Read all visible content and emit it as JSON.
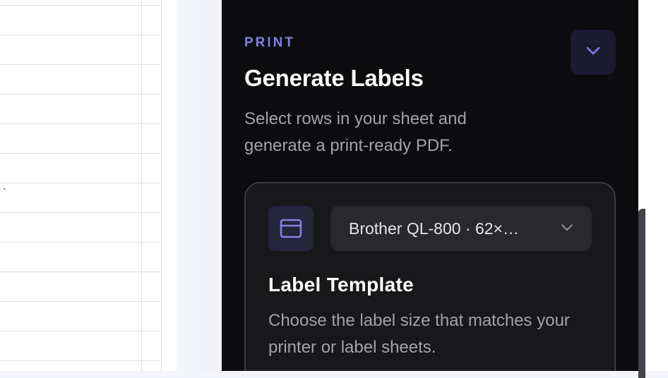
{
  "sheet": {
    "rows": [
      "",
      "",
      "",
      "",
      "",
      "",
      "`",
      "",
      "",
      "",
      "",
      "",
      ""
    ]
  },
  "panel": {
    "eyebrow": "PRINT",
    "title": "Generate Labels",
    "subtitle": "Select rows in your sheet and generate a print-ready PDF.",
    "collapse_icon": "chevron-down-icon",
    "accent_color": "#8080e6"
  },
  "template_card": {
    "icon": "label-template-icon",
    "selected_template": "Brother QL-800 · 62×…",
    "title": "Label Template",
    "description": "Choose the label size that matches your printer or label sheets."
  }
}
